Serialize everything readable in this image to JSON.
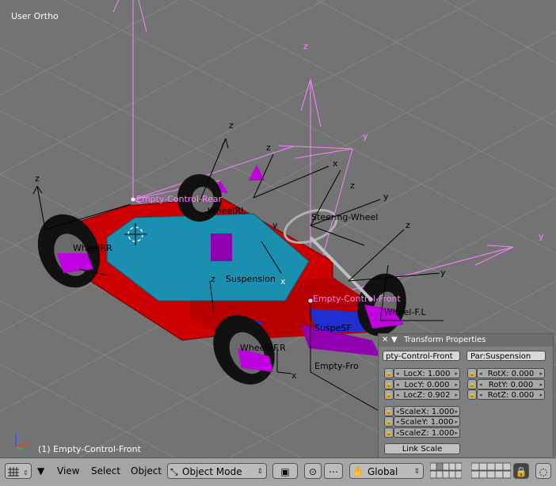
{
  "viewport": {
    "view_name": "User Ortho",
    "active_object": "(1) Empty-Control-Front",
    "labels": {
      "empty_rear": "Empty-Control-Rear",
      "empty_front": "Empty-Control-Front",
      "empty_front_short": "Empty-Fro",
      "steering": "Steering-Wheel",
      "suspension": "Suspension",
      "wheel_rear_l": "WheelRL",
      "wheel_rear_r": "WheelRR",
      "wheel_front_l": "Wheel-F.L",
      "wheel_front_r": "WheelRF.R",
      "susp_front": "SuspeSF",
      "axis_z": "z",
      "axis_y": "y",
      "axis_x": "x"
    }
  },
  "transform_panel": {
    "title": "Transform Properties",
    "object_name": "pty-Control-Front",
    "parent": "Par:Suspension",
    "loc": [
      {
        "label": "LocX:",
        "value": "1.000"
      },
      {
        "label": "LocY:",
        "value": "0.000"
      },
      {
        "label": "LocZ:",
        "value": "0.902"
      }
    ],
    "rot": [
      {
        "label": "RotX:",
        "value": "0.000"
      },
      {
        "label": "RotY:",
        "value": "0.000"
      },
      {
        "label": "RotZ:",
        "value": "0.000"
      }
    ],
    "scale": [
      {
        "label": "ScaleX:",
        "value": "1.000"
      },
      {
        "label": "ScaleY:",
        "value": "1.000"
      },
      {
        "label": "ScaleZ:",
        "value": "1.000"
      }
    ],
    "link_scale": "Link Scale"
  },
  "header": {
    "menus": [
      "View",
      "Select",
      "Object"
    ],
    "mode": "Object Mode",
    "orientation": "Global"
  },
  "colors": {
    "viewport_bg": "#737373",
    "grid": "#848484",
    "chassis_red": "#cc0000",
    "deck_blue": "#1a8fb0",
    "empty_pink": "#ff80ff",
    "magenta": "#9000b0",
    "header_bg": "#a5a5a5"
  },
  "icons": [
    "editor-type-grid-icon",
    "menu-triangle-icon",
    "object-mode-icon",
    "draw-type-cube-icon",
    "pivot-icon",
    "snap-icon",
    "hand-manipulator-icon",
    "lock-icon",
    "render-icon"
  ]
}
